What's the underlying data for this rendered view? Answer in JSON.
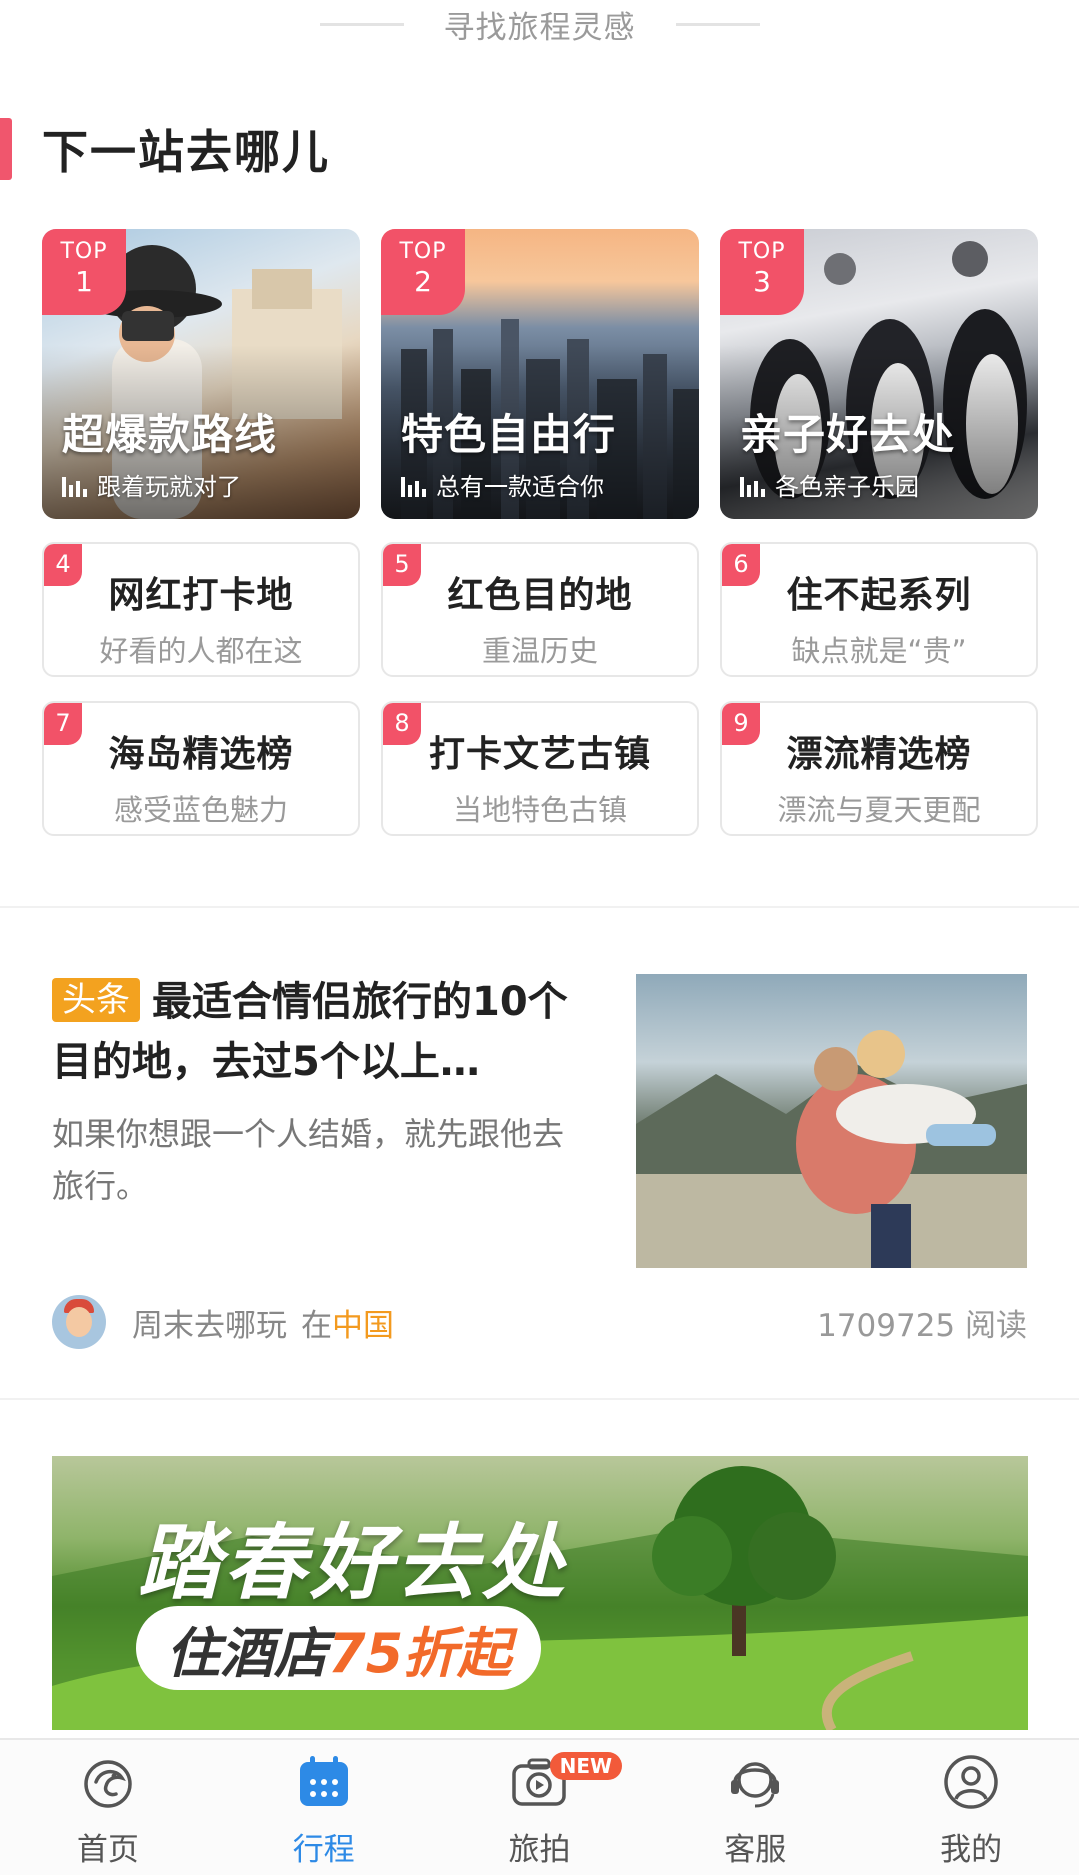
{
  "header": {
    "title": "寻找旅程灵感"
  },
  "section": {
    "title": "下一站去哪儿"
  },
  "top_cards": [
    {
      "badge_top": "TOP",
      "badge_num": "1",
      "title": "超爆款路线",
      "subtitle": "跟着玩就对了"
    },
    {
      "badge_top": "TOP",
      "badge_num": "2",
      "title": "特色自由行",
      "subtitle": "总有一款适合你"
    },
    {
      "badge_top": "TOP",
      "badge_num": "3",
      "title": "亲子好去处",
      "subtitle": "各色亲子乐园"
    }
  ],
  "rank_cards": [
    {
      "num": "4",
      "title": "网红打卡地",
      "subtitle": "好看的人都在这"
    },
    {
      "num": "5",
      "title": "红色目的地",
      "subtitle": "重温历史"
    },
    {
      "num": "6",
      "title": "住不起系列",
      "subtitle": "缺点就是“贵”"
    },
    {
      "num": "7",
      "title": "海岛精选榜",
      "subtitle": "感受蓝色魅力"
    },
    {
      "num": "8",
      "title": "打卡文艺古镇",
      "subtitle": "当地特色古镇"
    },
    {
      "num": "9",
      "title": "漂流精选榜",
      "subtitle": "漂流与夏天更配"
    }
  ],
  "article": {
    "tag": "头条",
    "title": "最适合情侣旅行的10个目的地，去过5个以上…",
    "desc": "如果你想跟一个人结婚，就先跟他去旅行。",
    "author": "周末去哪玩",
    "loc_prefix": "在",
    "loc": "中国",
    "reads": "1709725 阅读"
  },
  "banner": {
    "line1": "踏春好去处",
    "line2_prefix": "住酒店",
    "line2_highlight": "75折起"
  },
  "tabbar": {
    "items": [
      {
        "label": "首页",
        "icon": "home-dolphin-icon"
      },
      {
        "label": "行程",
        "icon": "calendar-icon"
      },
      {
        "label": "旅拍",
        "icon": "camera-play-icon",
        "badge": "NEW"
      },
      {
        "label": "客服",
        "icon": "headset-icon"
      },
      {
        "label": "我的",
        "icon": "user-icon"
      }
    ],
    "active": "行程"
  },
  "colors": {
    "accent": "#f25268",
    "active_tab": "#2d8ae6",
    "tag": "#f3a21f",
    "location": "#f39a1f",
    "banner_highlight": "#f26a2a"
  }
}
